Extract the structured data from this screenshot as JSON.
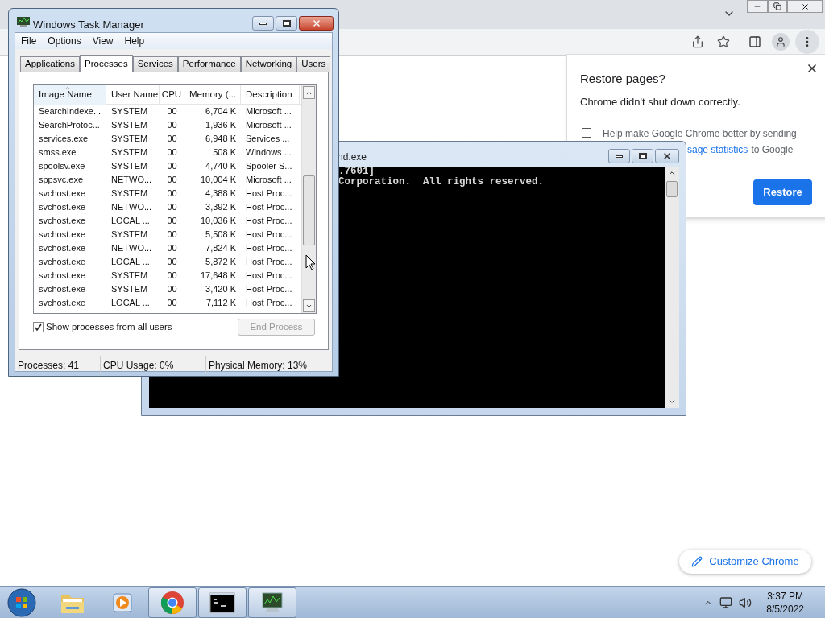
{
  "browser": {
    "restore_popup": {
      "title": "Restore pages?",
      "message": "Chrome didn't shut down correctly.",
      "checkbox": {
        "label": "Help make Google Chrome better by sending",
        "checked": false
      },
      "link": "sage statistics",
      "link_suffix": "to Google",
      "button": "Restore"
    },
    "customize_button": "Customize Chrome"
  },
  "console": {
    "title": "nd.exe",
    "lines": [
      ".7601]",
      "Corporation.  All rights reserved."
    ]
  },
  "task_manager": {
    "title": "Windows Task Manager",
    "menu": [
      "File",
      "Options",
      "View",
      "Help"
    ],
    "tabs": [
      {
        "label": "Applications",
        "selected": false
      },
      {
        "label": "Processes",
        "selected": true
      },
      {
        "label": "Services",
        "selected": false
      },
      {
        "label": "Performance",
        "selected": false
      },
      {
        "label": "Networking",
        "selected": false
      },
      {
        "label": "Users",
        "selected": false
      }
    ],
    "columns": [
      "Image Name",
      "User Name",
      "CPU",
      "Memory (...",
      "Description"
    ],
    "rows": [
      [
        "SearchIndexe...",
        "SYSTEM",
        "00",
        "6,704 K",
        "Microsoft ..."
      ],
      [
        "SearchProtoc...",
        "SYSTEM",
        "00",
        "1,936 K",
        "Microsoft ..."
      ],
      [
        "services.exe",
        "SYSTEM",
        "00",
        "6,948 K",
        "Services ..."
      ],
      [
        "smss.exe",
        "SYSTEM",
        "00",
        "508 K",
        "Windows ..."
      ],
      [
        "spoolsv.exe",
        "SYSTEM",
        "00",
        "4,740 K",
        "Spooler S..."
      ],
      [
        "sppsvc.exe",
        "NETWO...",
        "00",
        "10,004 K",
        "Microsoft ..."
      ],
      [
        "svchost.exe",
        "SYSTEM",
        "00",
        "4,388 K",
        "Host Proc..."
      ],
      [
        "svchost.exe",
        "NETWO...",
        "00",
        "3,392 K",
        "Host Proc..."
      ],
      [
        "svchost.exe",
        "LOCAL ...",
        "00",
        "10,036 K",
        "Host Proc..."
      ],
      [
        "svchost.exe",
        "SYSTEM",
        "00",
        "5,508 K",
        "Host Proc..."
      ],
      [
        "svchost.exe",
        "NETWO...",
        "00",
        "7,824 K",
        "Host Proc..."
      ],
      [
        "svchost.exe",
        "LOCAL ...",
        "00",
        "5,872 K",
        "Host Proc..."
      ],
      [
        "svchost.exe",
        "SYSTEM",
        "00",
        "17,648 K",
        "Host Proc..."
      ],
      [
        "svchost.exe",
        "SYSTEM",
        "00",
        "3,420 K",
        "Host Proc..."
      ],
      [
        "svchost.exe",
        "LOCAL ...",
        "00",
        "7,112 K",
        "Host Proc..."
      ]
    ],
    "show_all": {
      "label": "Show processes from all users",
      "checked": true
    },
    "end_process": {
      "label": "End Process",
      "disabled": true
    },
    "status": [
      "Processes: 41",
      "CPU Usage: 0%",
      "Physical Memory: 13%"
    ]
  },
  "taskbar": {
    "items": [
      {
        "kind": "explorer",
        "running": false
      },
      {
        "kind": "media",
        "running": false
      },
      {
        "kind": "chrome",
        "running": true
      },
      {
        "kind": "console",
        "running": true
      },
      {
        "kind": "taskmgr",
        "running": true
      }
    ],
    "time": "3:37 PM",
    "date": "8/5/2022"
  }
}
